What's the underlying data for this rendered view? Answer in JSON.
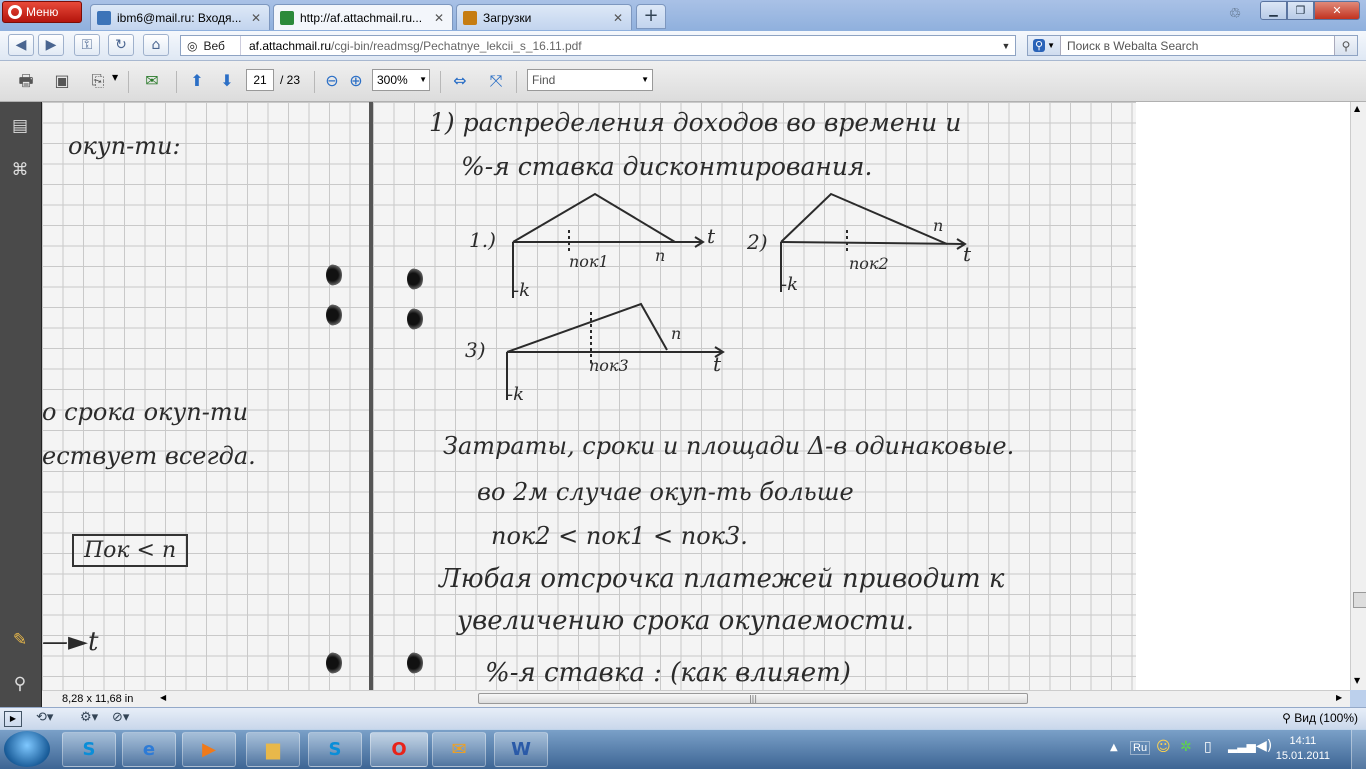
{
  "browser": {
    "menu_label": "Меню",
    "tabs": [
      {
        "label": "ibm6@mail.ru: Входя...",
        "color": "#3d74b8"
      },
      {
        "label": "http://af.attachmail.ru...",
        "color": "#2c8a3a"
      },
      {
        "label": "Загрузки",
        "color": "#c67d13"
      }
    ],
    "nav": {
      "web_label": "Веб",
      "url_host": "af.attachmail.ru",
      "url_path": "/cgi-bin/readmsg/Pechatnye_lekcii_s_16.11.pdf",
      "search_placeholder": "Поиск в Webalta Search"
    }
  },
  "pdf": {
    "page_current": "21",
    "page_total": "/  23",
    "zoom": "300%",
    "find_placeholder": "Find",
    "page_size": "8,28 x 11,68 in",
    "handwriting": {
      "left": [
        "окуп-ти:",
        "о срока окуп-ти",
        "ествует всегда.",
        "Пок < n"
      ],
      "right": [
        "1) распределения доходов во времени и",
        "%-я ставка дисконтирования.",
        "1.)",
        "пок1",
        "n",
        "t",
        "2)",
        "пок2",
        "n",
        "t",
        "3)",
        "пок3",
        "n",
        "t",
        "-k",
        "-k",
        "-k",
        "Затраты, сроки и площади Δ-в одинаковые.",
        "во 2м случае окуп-ть больше",
        "пок2 < пок1 < пок3.",
        "Любая отсрочка платежей приводит к",
        "увеличению срока окупаемости.",
        "%-я ставка : (как влияет)"
      ]
    }
  },
  "status": {
    "zoom_label": "Вид (100%)"
  },
  "taskbar": {
    "lang": "Ru",
    "time": "14:11",
    "date": "15.01.2011",
    "apps": [
      "skype",
      "internet-explorer",
      "media-player",
      "file-explorer",
      "skype-alt",
      "opera",
      "mail-agent",
      "word"
    ]
  }
}
